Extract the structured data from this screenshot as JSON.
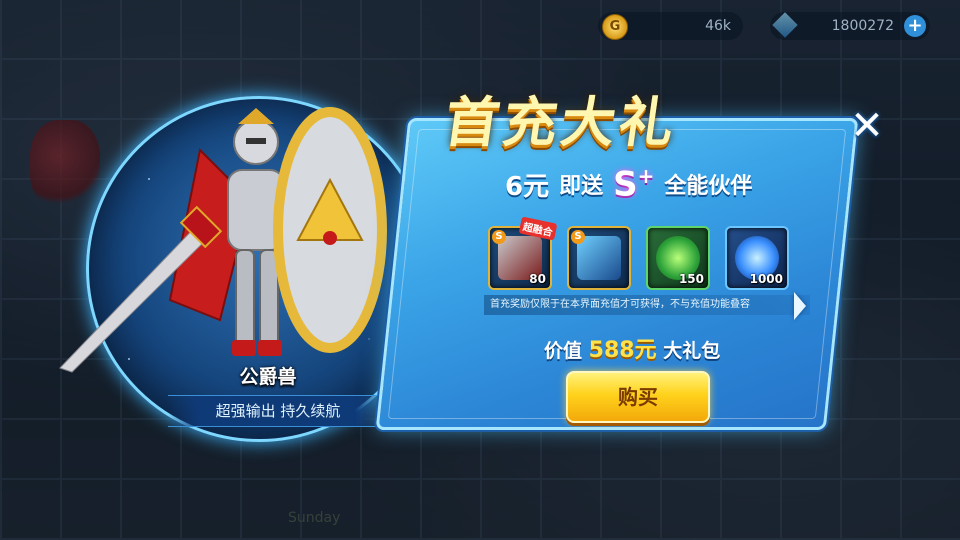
{
  "resources": {
    "gold": {
      "icon": "gold-coin-icon",
      "value": "46k"
    },
    "diamond": {
      "icon": "diamond-icon",
      "value": "1800272",
      "add_icon": "plus-icon"
    }
  },
  "hero": {
    "name": "公爵兽",
    "tagline": "超强输出 持久续航"
  },
  "panel": {
    "title": "首充大礼",
    "subtitle": {
      "amount": "6元",
      "mid": "即送",
      "rank": "S",
      "rank_plus": "+",
      "suffix": "全能伙伴"
    },
    "items": [
      {
        "name": "dukemon-card",
        "count": "80",
        "badge": "S",
        "ribbon": "超融合"
      },
      {
        "name": "armor-chip",
        "count": "",
        "badge": "S",
        "ribbon": ""
      },
      {
        "name": "green-crystal",
        "count": "150",
        "badge": "",
        "ribbon": ""
      },
      {
        "name": "blue-orb",
        "count": "1000",
        "badge": "",
        "ribbon": ""
      }
    ],
    "notice": "首充奖励仅限于在本界面充值才可获得，不与充值功能叠容",
    "value_prefix": "价值",
    "value_amount": "588元",
    "value_suffix": "大礼包",
    "buy_label": "购买",
    "close_label": "✕"
  },
  "background": {
    "scene_text": "Sunday"
  },
  "colors": {
    "panel_blue": "#3ba5e8",
    "gold": "#ffd21c",
    "title_yellow": "#fff6b0",
    "price_yellow": "#ffe14a"
  }
}
